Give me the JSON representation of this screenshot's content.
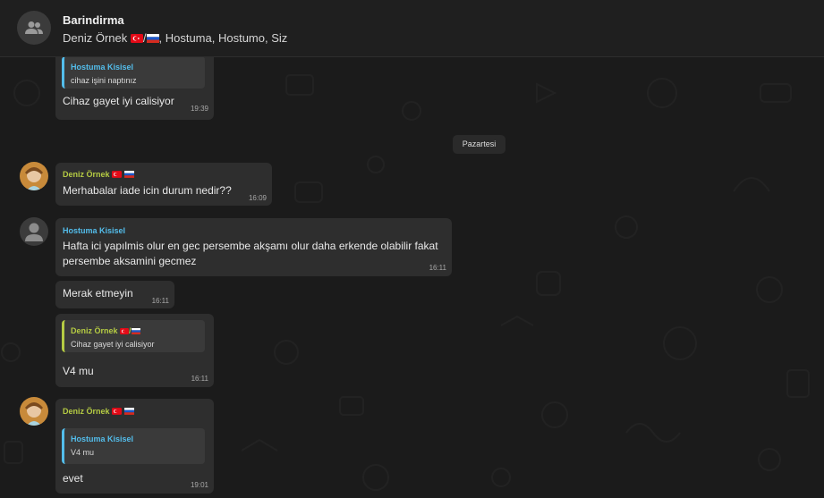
{
  "header": {
    "title": "Barindirma",
    "members_prefix": "Deniz Örnek",
    "members_suffix": ", Hostuma, Hostumo, Siz",
    "members_separator": "/"
  },
  "date_separator": "Pazartesi",
  "colors": {
    "deniz_name": "#b5cb43",
    "hostuma_name": "#53bdeb",
    "bubble": "#2e2e2e",
    "quote_bg": "#3a3a3a"
  },
  "messages": [
    {
      "quote": {
        "name": "Hostuma Kisisel",
        "text": "cihaz işini naptınız"
      },
      "text": "Cihaz gayet iyi calisiyor",
      "time": "19:39"
    },
    {
      "sender": "Deniz Örnek",
      "text": "Merhabalar iade icin durum nedir??",
      "time": "16:09"
    },
    {
      "sender": "Hostuma Kisisel",
      "text_line1": "Hafta ici yapılmis olur en gec persembe akşamı olur daha erkende olabilir fakat",
      "text_line2": "persembe aksamini gecmez",
      "time": "16:11"
    },
    {
      "text": "Merak etmeyin",
      "time": "16:11"
    },
    {
      "quote": {
        "name": "Deniz Örnek",
        "separator": "/",
        "text": "Cihaz gayet iyi calisiyor"
      },
      "text": "V4 mu",
      "time": "16:11"
    },
    {
      "sender": "Deniz Örnek",
      "quote": {
        "name": "Hostuma Kisisel",
        "text": "V4 mu"
      },
      "text": "evet",
      "time": "19:01"
    }
  ]
}
